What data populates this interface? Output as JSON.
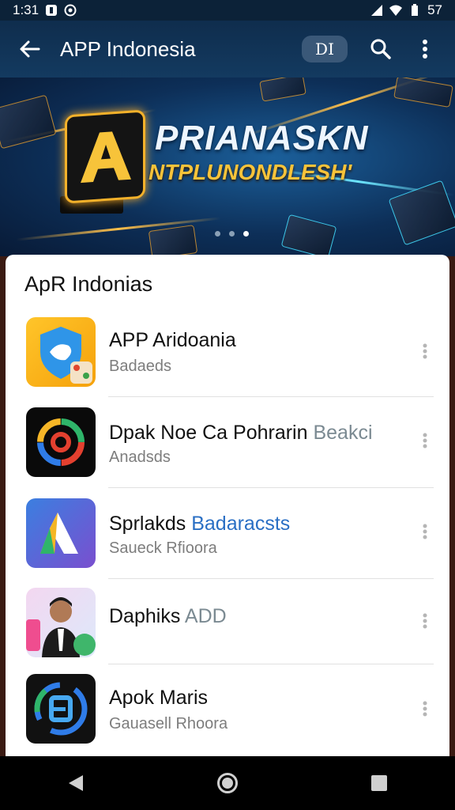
{
  "status": {
    "time": "1:31",
    "battery": "57"
  },
  "appbar": {
    "title": "APP Indonesia",
    "chip": "DI"
  },
  "banner": {
    "title": "PRIANASKN",
    "subtitle": "NTPLUNONDLESH'",
    "dots": 3,
    "active_dot": 3
  },
  "list": {
    "title": "ApR Indonias",
    "items": [
      {
        "name": "APP Aridoania",
        "tag": "",
        "sub": "Badaeds"
      },
      {
        "name": "Dpak Noe Ca Pohrarin",
        "tag": "Beakci",
        "sub": "Anadsds"
      },
      {
        "name": "Sprlakds",
        "tag": "Badaracsts",
        "sub": "Saueck Rfioora"
      },
      {
        "name": "Daphiks",
        "tag": "ADD",
        "sub": ""
      },
      {
        "name": "Apok Maris",
        "tag": "",
        "sub": "Gauasell Rhoora"
      }
    ]
  },
  "icons": {
    "back": "arrow-left-icon",
    "search": "search-icon",
    "menu": "more-vert-icon",
    "nav_back": "nav-back-icon",
    "nav_home": "nav-home-icon",
    "nav_recents": "nav-recents-icon"
  },
  "colors": {
    "appbar": "#133a60",
    "accent": "#f3b12a",
    "tag_blue": "#2a6fc4"
  }
}
